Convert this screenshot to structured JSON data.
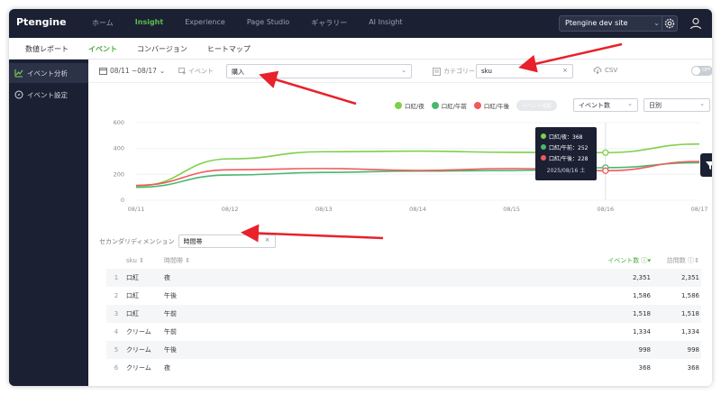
{
  "topbar": {
    "logo": "Ptengine",
    "nav": [
      "ホーム",
      "Insight",
      "Experience",
      "Page Studio",
      "ギャラリー",
      "AI Insight"
    ],
    "active_nav": "Insight",
    "site_select": "Ptengine dev site"
  },
  "subnav": {
    "tabs": [
      "数値レポート",
      "イベント",
      "コンバージョン",
      "ヒートマップ"
    ],
    "active": "イベント"
  },
  "sidebar": {
    "items": [
      "イベント分析",
      "イベント設定"
    ]
  },
  "filterbar": {
    "date_range": "08/11 ~08/17",
    "event_label": "イベント",
    "event_value": "購入",
    "category_label": "カテゴリー",
    "category_value": "sku",
    "csv_label": "CSV",
    "toggle_label": "OFF"
  },
  "chart_controls": {
    "legend": [
      "口紅/夜",
      "口紅/午前",
      "口紅/午後"
    ],
    "compare_label": "イベント比較",
    "metric_select": "イベント数",
    "granularity_select": "日別"
  },
  "colors": {
    "series1": "#7ed04b",
    "series2": "#48b870",
    "series3": "#ef5b5b",
    "brand_dark": "#1b2033",
    "accent": "#4aaa3a"
  },
  "chart_data": {
    "type": "line",
    "categories": [
      "08/11",
      "08/12",
      "08/13",
      "08/14",
      "08/15",
      "08/16",
      "08/17"
    ],
    "ylim": [
      0,
      600
    ],
    "yticks": [
      0,
      200,
      400,
      600
    ],
    "series": [
      {
        "name": "口紅/夜",
        "values": [
          110,
          320,
          375,
          380,
          370,
          368,
          435
        ]
      },
      {
        "name": "口紅/午前",
        "values": [
          100,
          195,
          215,
          225,
          230,
          252,
          290
        ]
      },
      {
        "name": "口紅/午後",
        "values": [
          115,
          235,
          245,
          230,
          245,
          228,
          300
        ]
      }
    ],
    "tooltip": {
      "rows": [
        "口紅/夜：368",
        "口紅/午前：252",
        "口紅/午後：228"
      ],
      "date": "2025/08/16 土"
    }
  },
  "secondary_dimension": {
    "label": "セカンダリディメンション",
    "value": "時間帯"
  },
  "table": {
    "headers": {
      "sku": "sku",
      "time": "時間帯",
      "events": "イベント数",
      "visits": "訪問数"
    },
    "rows": [
      {
        "idx": "1",
        "sku": "口紅",
        "time": "夜",
        "events": "2,351",
        "visits": "2,351"
      },
      {
        "idx": "2",
        "sku": "口紅",
        "time": "午後",
        "events": "1,586",
        "visits": "1,586"
      },
      {
        "idx": "3",
        "sku": "口紅",
        "time": "午前",
        "events": "1,518",
        "visits": "1,518"
      },
      {
        "idx": "4",
        "sku": "クリーム",
        "time": "午前",
        "events": "1,334",
        "visits": "1,334"
      },
      {
        "idx": "5",
        "sku": "クリーム",
        "time": "午後",
        "events": "998",
        "visits": "998"
      },
      {
        "idx": "6",
        "sku": "クリーム",
        "time": "夜",
        "events": "368",
        "visits": "368"
      }
    ]
  }
}
